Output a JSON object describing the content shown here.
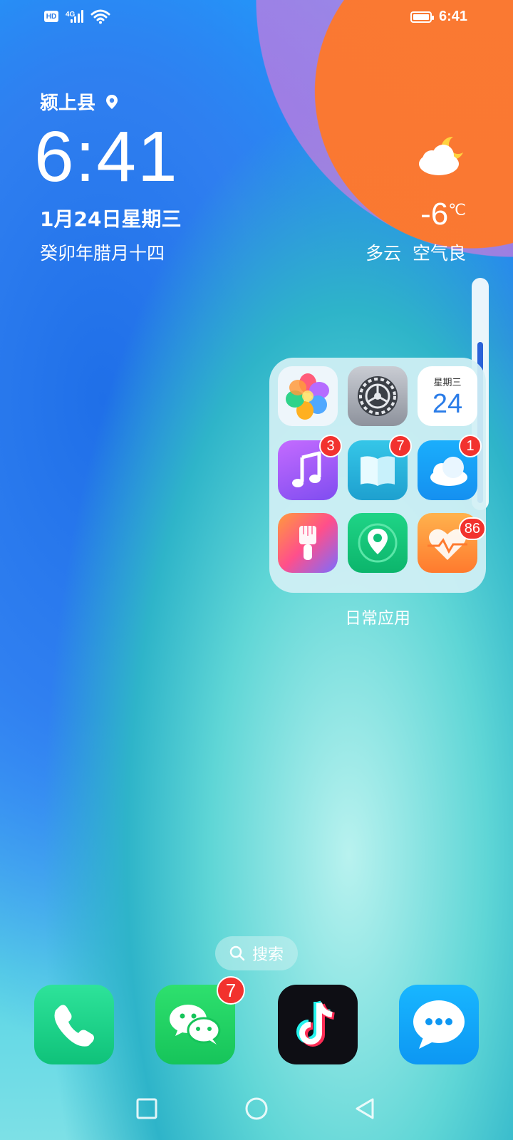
{
  "status_bar": {
    "hd_label": "HD",
    "network_label": "4G",
    "time": "6:41"
  },
  "clock_widget": {
    "location": "颍上县",
    "time": "6:41",
    "date": "1月24日星期三",
    "lunar_date": "癸卯年腊月十四"
  },
  "weather_widget": {
    "icon": "cloud-moon-icon",
    "temperature": "-6",
    "unit": "℃",
    "condition": "多云",
    "air_quality": "空气良"
  },
  "folder": {
    "label": "日常应用",
    "apps": [
      {
        "name": "photos-icon"
      },
      {
        "name": "settings-icon"
      },
      {
        "name": "calendar-icon",
        "weekday": "星期三",
        "day": "24"
      },
      {
        "name": "music-icon",
        "badge": "3"
      },
      {
        "name": "books-icon",
        "badge": "7"
      },
      {
        "name": "cloud-icon",
        "badge": "1"
      },
      {
        "name": "themes-icon"
      },
      {
        "name": "find-device-icon"
      },
      {
        "name": "health-icon",
        "badge": "86"
      }
    ]
  },
  "search": {
    "label": "搜索"
  },
  "dock": [
    {
      "name": "phone-icon"
    },
    {
      "name": "wechat-icon",
      "badge": "7"
    },
    {
      "name": "tiktok-icon"
    },
    {
      "name": "messages-icon"
    }
  ],
  "colors": {
    "badge": "#f2322e",
    "scroll_thumb": "#2a62d8"
  }
}
